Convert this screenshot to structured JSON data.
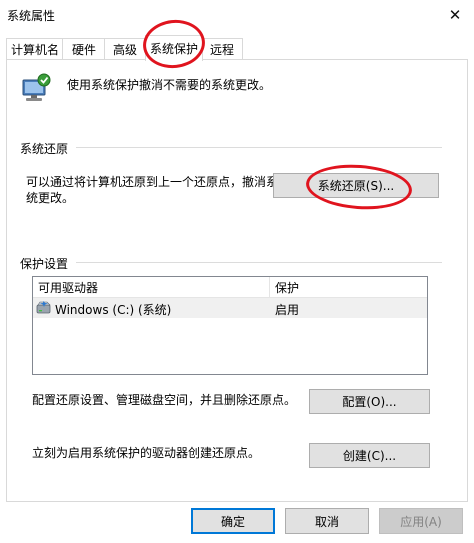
{
  "window": {
    "title": "系统属性",
    "close_glyph": "✕"
  },
  "tabs": [
    {
      "label": "计算机名"
    },
    {
      "label": "硬件"
    },
    {
      "label": "高级"
    },
    {
      "label": "系统保护",
      "active": true
    },
    {
      "label": "远程"
    }
  ],
  "header": {
    "description": "使用系统保护撤消不需要的系统更改。"
  },
  "restore": {
    "group_label": "系统还原",
    "text_line1": "可以通过将计算机还原到上一个还原点，撤消系",
    "text_line2": "统更改。",
    "button_label": "系统还原(S)..."
  },
  "protection": {
    "group_label": "保护设置",
    "columns": [
      "可用驱动器",
      "保护"
    ],
    "rows": [
      {
        "drive": "Windows (C:) (系统)",
        "status": "启用"
      }
    ],
    "configure_text": "配置还原设置、管理磁盘空间，并且删除还原点。",
    "configure_button": "配置(O)...",
    "create_text": "立刻为启用系统保护的驱动器创建还原点。",
    "create_button": "创建(C)..."
  },
  "footer": {
    "ok": "确定",
    "cancel": "取消",
    "apply": "应用(A)"
  },
  "icons": {
    "system_protection": "computer-shield-icon",
    "drive": "drive-icon"
  },
  "colors": {
    "annotation_red": "#e0141e",
    "default_button_border": "#0078d7"
  }
}
